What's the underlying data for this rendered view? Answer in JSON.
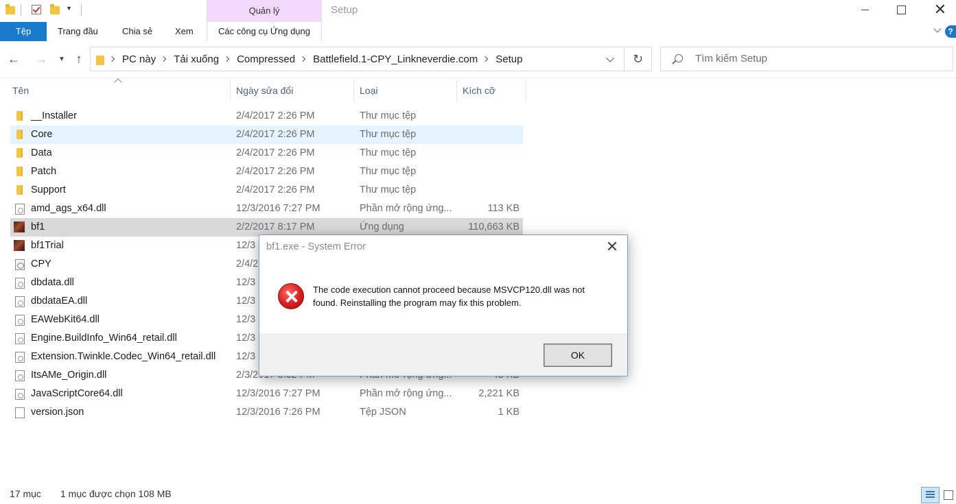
{
  "window": {
    "title": "Setup",
    "manage_tab": "Quản lý"
  },
  "ribbon": {
    "file": "Tệp",
    "home": "Trang đầu",
    "share": "Chia sẻ",
    "view": "Xem",
    "app_tools": "Các công cụ Ứng dụng"
  },
  "address": {
    "crumbs": [
      "PC này",
      "Tải xuống",
      "Compressed",
      "Battlefield.1-CPY_Linkneverdie.com",
      "Setup"
    ]
  },
  "search": {
    "placeholder": "Tìm kiếm Setup"
  },
  "columns": {
    "name": "Tên",
    "date": "Ngày sửa đổi",
    "type": "Loại",
    "size": "Kích cỡ"
  },
  "files": [
    {
      "name": "__Installer",
      "date": "2/4/2017 2:26 PM",
      "type": "Thư mục tệp",
      "size": "",
      "icon": "folder-icon"
    },
    {
      "name": "Core",
      "date": "2/4/2017 2:26 PM",
      "type": "Thư mục tệp",
      "size": "",
      "icon": "folder-icon"
    },
    {
      "name": "Data",
      "date": "2/4/2017 2:26 PM",
      "type": "Thư mục tệp",
      "size": "",
      "icon": "folder-icon"
    },
    {
      "name": "Patch",
      "date": "2/4/2017 2:26 PM",
      "type": "Thư mục tệp",
      "size": "",
      "icon": "folder-icon"
    },
    {
      "name": "Support",
      "date": "2/4/2017 2:26 PM",
      "type": "Thư mục tệp",
      "size": "",
      "icon": "folder-icon"
    },
    {
      "name": "amd_ags_x64.dll",
      "date": "12/3/2016 7:27 PM",
      "type": "Phần mở rộng ứng...",
      "size": "113 KB",
      "icon": "dll-file-icon"
    },
    {
      "name": "bf1",
      "date": "2/2/2017 8:17 PM",
      "type": "Ứng dụng",
      "size": "110,663 KB",
      "icon": "app-icon"
    },
    {
      "name": "bf1Trial",
      "date": "12/3",
      "type": "",
      "size": "",
      "icon": "app-icon"
    },
    {
      "name": "CPY",
      "date": "2/4/2",
      "type": "",
      "size": "",
      "icon": "settings-file-icon"
    },
    {
      "name": "dbdata.dll",
      "date": "12/3",
      "type": "",
      "size": "",
      "icon": "dll-file-icon"
    },
    {
      "name": "dbdataEA.dll",
      "date": "12/3",
      "type": "",
      "size": "",
      "icon": "dll-file-icon"
    },
    {
      "name": "EAWebKit64.dll",
      "date": "12/3",
      "type": "",
      "size": "",
      "icon": "dll-file-icon"
    },
    {
      "name": "Engine.BuildInfo_Win64_retail.dll",
      "date": "12/3",
      "type": "",
      "size": "",
      "icon": "dll-file-icon"
    },
    {
      "name": "Extension.Twinkle.Codec_Win64_retail.dll",
      "date": "12/3",
      "type": "",
      "size": "",
      "icon": "dll-file-icon"
    },
    {
      "name": "ItsAMe_Origin.dll",
      "date": "2/3/2017 3:32 PM",
      "type": "Phần mở rộng ứng...",
      "size": "48 KB",
      "icon": "dll-file-icon"
    },
    {
      "name": "JavaScriptCore64.dll",
      "date": "12/3/2016 7:27 PM",
      "type": "Phần mở rộng ứng...",
      "size": "2,221 KB",
      "icon": "dll-file-icon"
    },
    {
      "name": "version.json",
      "date": "12/3/2016 7:26 PM",
      "type": "Tệp JSON",
      "size": "1 KB",
      "icon": "json-file-icon"
    }
  ],
  "hover_index": 1,
  "selected_index": 6,
  "status": {
    "count": "17 mục",
    "selection": "1 mục được chọn  108 MB"
  },
  "dialog": {
    "title": "bf1.exe - System Error",
    "message": "The code execution cannot proceed because MSVCP120.dll was not found. Reinstalling the program may fix this problem.",
    "ok": "OK"
  },
  "colors": {
    "accent": "#1979ca",
    "manage_tab": "#f2d9fc",
    "hover_row": "#e5f3ff",
    "selected_row": "#d9d9d9",
    "error_icon": "#d81e1e"
  }
}
